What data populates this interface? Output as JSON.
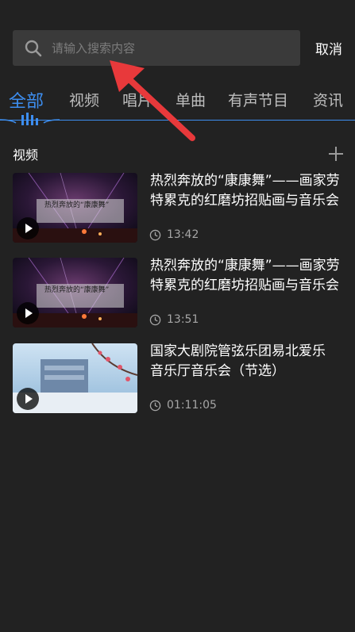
{
  "search": {
    "placeholder": "请输入搜索内容",
    "cancel_label": "取消"
  },
  "tabs": [
    {
      "label": "全部",
      "active": true
    },
    {
      "label": "视频",
      "active": false
    },
    {
      "label": "唱片",
      "active": false
    },
    {
      "label": "单曲",
      "active": false
    },
    {
      "label": "有声节目",
      "active": false
    },
    {
      "label": "资讯",
      "active": false
    }
  ],
  "section": {
    "title": "视频"
  },
  "videos": [
    {
      "title_line1": "热烈奔放的“康康舞”——画家劳",
      "title_line2": "特累克的红磨坊招贴画与音乐会",
      "duration": "13:42",
      "thumb_text": "热烈奔放的“康康舞”"
    },
    {
      "title_line1": "热烈奔放的“康康舞”——画家劳",
      "title_line2": "特累克的红磨坊招贴画与音乐会",
      "duration": "13:51",
      "thumb_text": "热烈奔放的“康康舞”"
    },
    {
      "title_line1": "国家大剧院管弦乐团易北爱乐",
      "title_line2": "音乐厅音乐会（节选）",
      "duration": "01:11:05",
      "thumb_text": ""
    }
  ],
  "colors": {
    "accent": "#3d8ef0",
    "background": "#222222",
    "search_bg": "#3a3a3a"
  }
}
